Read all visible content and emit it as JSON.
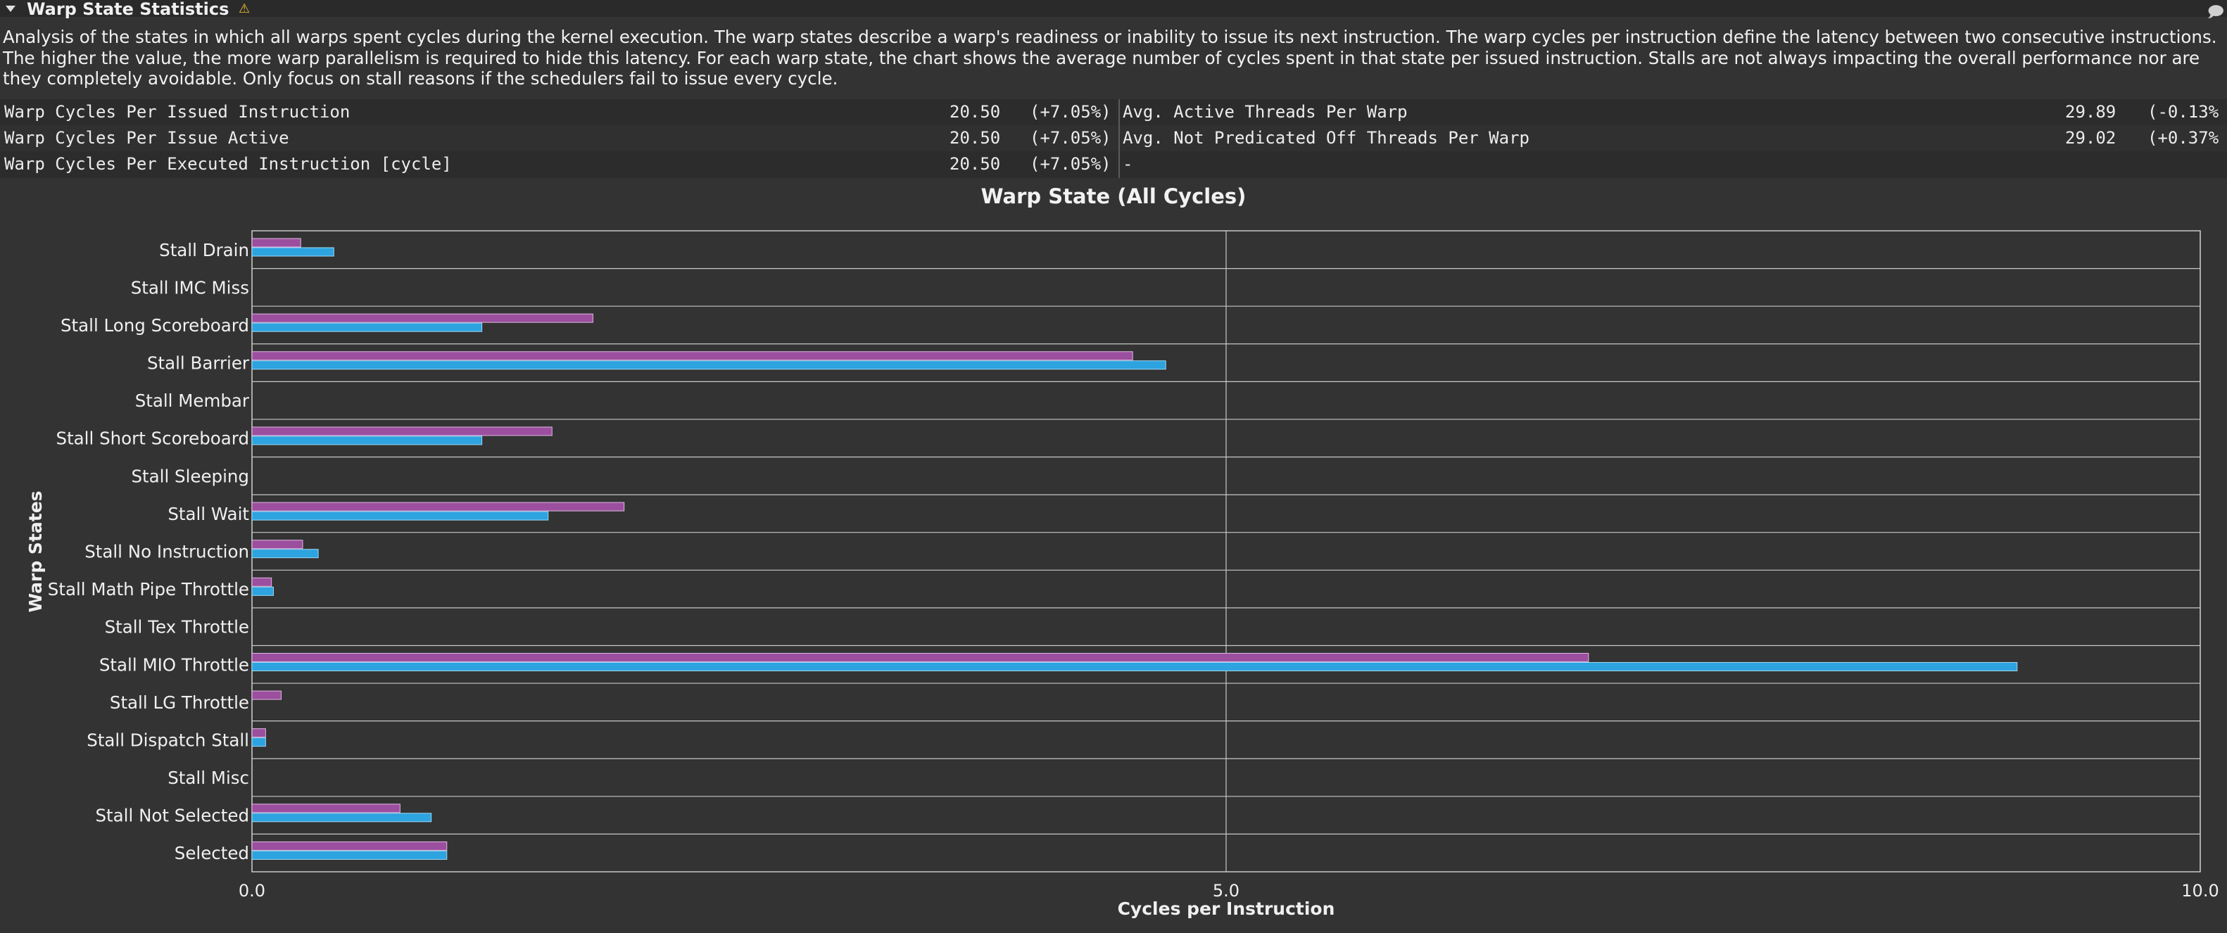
{
  "section": {
    "title": "Warp State Statistics",
    "warning_icon": "warning-icon",
    "corner_icon": "comment-icon"
  },
  "description": "Analysis of the states in which all warps spent cycles during the kernel execution. The warp states describe a warp's readiness or inability to issue its next instruction. The warp cycles per instruction define the latency between two consecutive instructions. The higher the value, the more warp parallelism is required to hide this latency. For each warp state, the chart shows the average number of cycles spent in that state per issued instruction. Stalls are not always impacting the overall performance nor are they completely avoidable. Only focus on stall reasons if the schedulers fail to issue every cycle.",
  "metrics": {
    "left": [
      {
        "label": "Warp Cycles Per Issued Instruction",
        "value": "20.50",
        "delta": "(+7.05%)"
      },
      {
        "label": "Warp Cycles Per Issue Active",
        "value": "20.50",
        "delta": "(+7.05%)"
      },
      {
        "label": "Warp Cycles Per Executed Instruction [cycle]",
        "value": "20.50",
        "delta": "(+7.05%)"
      }
    ],
    "right": [
      {
        "label": "Avg. Active Threads Per Warp",
        "value": "29.89",
        "delta": "(-0.13%"
      },
      {
        "label": "Avg. Not Predicated Off Threads Per Warp",
        "value": "29.02",
        "delta": "(+0.37%"
      },
      {
        "label": "-",
        "value": "",
        "delta": ""
      }
    ]
  },
  "colors": {
    "series_a": "#9b4f9e",
    "series_b": "#2da3df",
    "grid": "#c8c8c8",
    "background": "#333333"
  },
  "chart_data": {
    "type": "bar",
    "orientation": "horizontal",
    "title": "Warp State (All Cycles)",
    "xlabel": "Cycles per Instruction",
    "ylabel": "Warp States",
    "xlim": [
      0,
      10
    ],
    "xticks": [
      "0.0",
      "5.0",
      "10.0"
    ],
    "xtick_values": [
      0,
      5,
      10
    ],
    "grid": true,
    "categories": [
      "Stall Drain",
      "Stall IMC Miss",
      "Stall Long Scoreboard",
      "Stall Barrier",
      "Stall Membar",
      "Stall Short Scoreboard",
      "Stall Sleeping",
      "Stall Wait",
      "Stall No Instruction",
      "Stall Math Pipe Throttle",
      "Stall Tex Throttle",
      "Stall MIO Throttle",
      "Stall LG Throttle",
      "Stall Dispatch Stall",
      "Stall Misc",
      "Stall Not Selected",
      "Selected"
    ],
    "series": [
      {
        "values": [
          0.25,
          0.0,
          1.75,
          4.52,
          0.0,
          1.54,
          0.0,
          1.91,
          0.26,
          0.1,
          0.0,
          6.86,
          0.15,
          0.07,
          0.0,
          0.76,
          1.0
        ]
      },
      {
        "values": [
          0.42,
          0.0,
          1.18,
          4.69,
          0.0,
          1.18,
          0.0,
          1.52,
          0.34,
          0.11,
          0.0,
          9.06,
          0.0,
          0.07,
          0.0,
          0.92,
          1.0
        ]
      }
    ]
  }
}
